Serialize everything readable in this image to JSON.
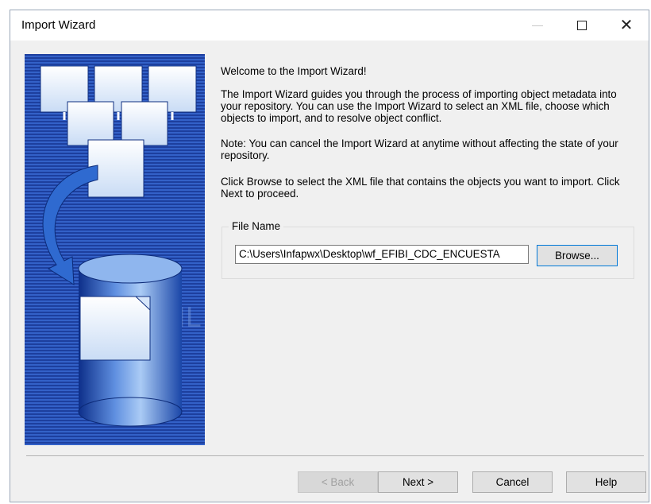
{
  "window": {
    "title": "Import Wizard"
  },
  "content": {
    "welcome": "Welcome to the Import Wizard!",
    "description": "The Import Wizard guides you through the process of importing object metadata into your repository. You can use the Import Wizard to select an XML file, choose which objects to import, and to resolve object conflict.",
    "note": "Note: You can cancel the Import Wizard at anytime without affecting the state of your repository.",
    "instruction": "Click Browse to select the XML file that contains the objects you want to import. Click Next to proceed."
  },
  "file_group": {
    "label": "File Name",
    "value": "C:\\Users\\Infapwx\\Desktop\\wf_EFIBI_CDC_ENCUESTA",
    "browse_label": "Browse..."
  },
  "banner": {
    "watermark": "XML"
  },
  "buttons": {
    "back": "< Back",
    "next": "Next >",
    "cancel": "Cancel",
    "help": "Help"
  }
}
